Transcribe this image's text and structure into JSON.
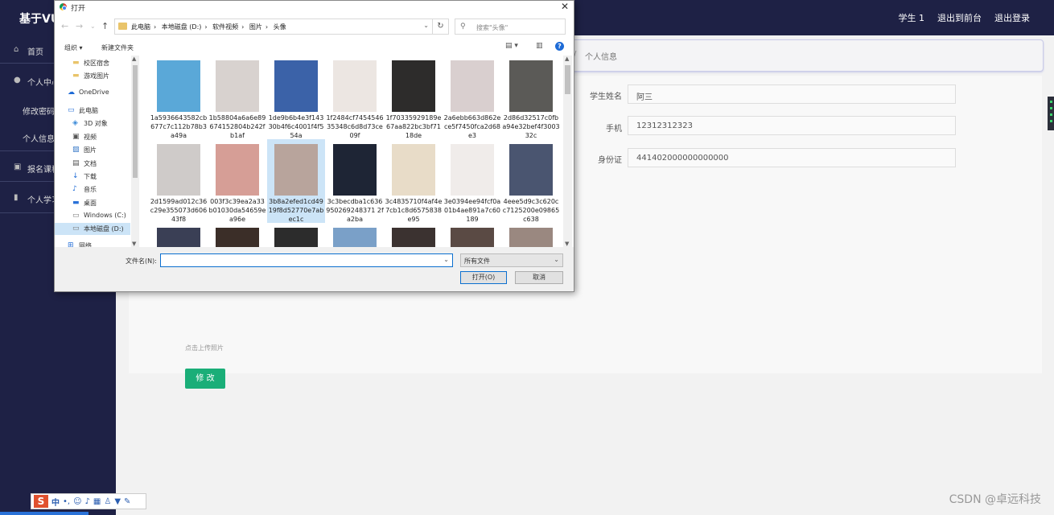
{
  "app": {
    "brand": "基于VU",
    "top_links": [
      "学生 1",
      "退出到前台",
      "退出登录"
    ]
  },
  "sidebar": {
    "items": [
      {
        "label": "首页",
        "icon": "home-icon"
      },
      {
        "label": "个人中心",
        "icon": "user-icon"
      },
      {
        "label": "修改密码",
        "icon": ""
      },
      {
        "label": "个人信息",
        "icon": ""
      },
      {
        "label": "报名课程",
        "icon": "signup-icon"
      },
      {
        "label": "个人学习",
        "icon": "chart-icon"
      }
    ]
  },
  "breadcrumb": {
    "sep": "/",
    "current": "个人信息"
  },
  "form": {
    "fields": [
      {
        "label": "学生姓名",
        "value": "阿三"
      },
      {
        "label": "手机",
        "value": "12312312323"
      },
      {
        "label": "身份证",
        "value": "441402000000000000"
      }
    ],
    "upload_tip": "点击上传照片",
    "submit_label": "修 改"
  },
  "watermark": "CSDN @卓远科技",
  "ime": {
    "logo": "S",
    "mode": "中"
  },
  "dialog": {
    "title": "打开",
    "close": "✕",
    "path": [
      "此电脑",
      "本地磁盘 (D:)",
      "软件视频",
      "图片",
      "头像"
    ],
    "search_placeholder": "搜索\"头像\"",
    "organize": "组织 ▾",
    "new_folder": "新建文件夹",
    "help": "?",
    "nav_items": [
      {
        "label": "校区宿舍",
        "icon": "folder-icon"
      },
      {
        "label": "游戏图片",
        "icon": "folder-icon"
      },
      {
        "label": "OneDrive",
        "icon": "cloud-icon"
      },
      {
        "label": "此电脑",
        "icon": "computer-icon"
      },
      {
        "label": "3D 对象",
        "icon": "cube-icon"
      },
      {
        "label": "视频",
        "icon": "video-icon"
      },
      {
        "label": "图片",
        "icon": "picture-icon"
      },
      {
        "label": "文档",
        "icon": "document-icon"
      },
      {
        "label": "下载",
        "icon": "download-icon"
      },
      {
        "label": "音乐",
        "icon": "music-icon"
      },
      {
        "label": "桌面",
        "icon": "desktop-icon"
      },
      {
        "label": "Windows (C:)",
        "icon": "drive-icon"
      },
      {
        "label": "本地磁盘 (D:)",
        "icon": "drive-icon"
      },
      {
        "label": "网络",
        "icon": "network-icon"
      }
    ],
    "files": [
      {
        "name": "1a5936643582cb677c7c112b78b3a49a",
        "color": "#5aa8d8"
      },
      {
        "name": "1b58804a6a6e89674152804b242fb1af",
        "color": "#d8d2cf"
      },
      {
        "name": "1de9b6b4e3f14330b4f6c4001f4f554a",
        "color": "#3b62a8"
      },
      {
        "name": "1f2484cf745454635348c6d8d73ce09f",
        "color": "#ece6e2"
      },
      {
        "name": "1f70335929189e67aa822bc3bf7118de",
        "color": "#2d2c2b"
      },
      {
        "name": "2a6ebb663d862ece5f7450fca2d68e3",
        "color": "#d9cfcf"
      },
      {
        "name": "2d86d32517c0fba94e32bef4f300332c",
        "color": "#5b5a57"
      },
      {
        "name": "2d1599ad012c36c29e355073d60643f8",
        "color": "#cfcbc9"
      },
      {
        "name": "003f3c39ea2a33b01030da54659ea96e",
        "color": "#d69e96"
      },
      {
        "name": "3b8a2efed1cd4919f8d52770e7abec1c",
        "color": "#b8a49c"
      },
      {
        "name": "3c3becdba1c636950269248371 2fa2ba",
        "color": "#1e2535"
      },
      {
        "name": "3c4835710f4af4e7cb1c8d6575838e95",
        "color": "#e8dcc8"
      },
      {
        "name": "3e0394ee94fcf0a01b4ae891a7c60189",
        "color": "#f0ecea"
      },
      {
        "name": "4eee5d9c3c620cc7125200e09865c638",
        "color": "#4a5570"
      },
      {
        "name": "",
        "color": "#3a3f55"
      },
      {
        "name": "",
        "color": "#3b2e28"
      },
      {
        "name": "",
        "color": "#2c2c2c"
      },
      {
        "name": "",
        "color": "#7aa0c8"
      },
      {
        "name": "",
        "color": "#3b3230"
      },
      {
        "name": "",
        "color": "#5a4a44"
      },
      {
        "name": "",
        "color": "#9a8880"
      }
    ],
    "filename_label": "文件名(N):",
    "filename_value": "",
    "filetype": "所有文件",
    "open_label": "打开(O)",
    "cancel_label": "取消"
  }
}
